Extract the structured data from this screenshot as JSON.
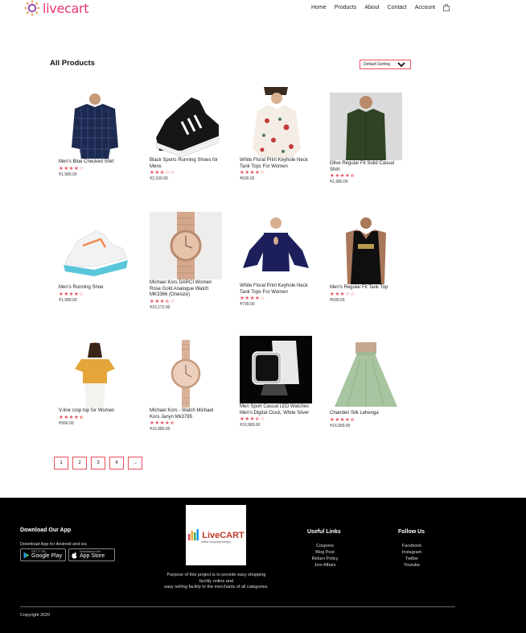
{
  "brand": {
    "name": "livecart",
    "color": "#e8376f"
  },
  "nav": {
    "home": "Home",
    "products": "Products",
    "about": "About",
    "contact": "Contact",
    "account": "Account"
  },
  "page": {
    "title": "All Products",
    "sort_value": "Default Sorting"
  },
  "products": [
    {
      "name": "Men's Blue Checked Shirt",
      "rating": 4,
      "price": "₹1,580.00"
    },
    {
      "name": "Black Sports Running Shoes for Mens",
      "rating": 3,
      "price": "₹2,100.00"
    },
    {
      "name": "White Floral Print Keyhole Neck Tank Tops For Women",
      "rating": 4,
      "price": "₹500.00"
    },
    {
      "name": "Olive Regular Fit Solid Casual Shirt",
      "rating": 4.5,
      "price": "₹1,980.00"
    },
    {
      "name": "Men's Running Shoe",
      "rating": 4,
      "price": "₹1,580.00"
    },
    {
      "name": "Michael Kors DARCI Women Rose Gold Analogue Watch MK3366 (Onesize)",
      "rating": 3.5,
      "price": "₹10,172.00"
    },
    {
      "name": "White Floral Print Keyhole Neck Tank Tops For Women",
      "rating": 4,
      "price": "₹799.00"
    },
    {
      "name": "Men's Regular Fit Tank Top",
      "rating": 3,
      "price": "₹500.00"
    },
    {
      "name": "V-line crop top for Women",
      "rating": 4.5,
      "price": "₹990.00"
    },
    {
      "name": "Michael Kors - Watch Michael Kors Janyn Mk3785",
      "rating": 4.5,
      "price": "₹16,980.00"
    },
    {
      "name": "Men Sport Casual LED Watches Men's Digital Clock, White Silver",
      "rating": 3.5,
      "price": "₹10,980.00"
    },
    {
      "name": "Chanderi Silk Lehenga",
      "rating": 4.5,
      "price": "₹16,999.00"
    }
  ],
  "pagination": {
    "pages": [
      "1",
      "2",
      "3",
      "4"
    ],
    "next": "→"
  },
  "footer": {
    "download_title": "Download Our App",
    "download_text": "Download App for Android and ios",
    "google_play_small": "GET IT ON",
    "google_play": "Google Play",
    "app_store_small": "Download on the",
    "app_store": "App Store",
    "logo_text": "LiveCART",
    "logo_tagline": "online shopping therapy",
    "purpose_line1": "Purpose of this project is to provide easy shopping",
    "purpose_line2": "facility online and",
    "purpose_line3": "easy selling facility to the merchants of all categories.",
    "useful_title": "Useful Links",
    "useful_links": [
      "Coupons",
      "Blog Post",
      "Return Policy",
      "Join Affairs"
    ],
    "follow_title": "Follow Us",
    "follow_links": [
      "Facebook",
      "Instagram",
      "Twitter",
      "Youtube"
    ],
    "copyright": "Copyright 2020"
  },
  "colors": {
    "accent": "#e8505b",
    "footer_bg": "#000000"
  }
}
